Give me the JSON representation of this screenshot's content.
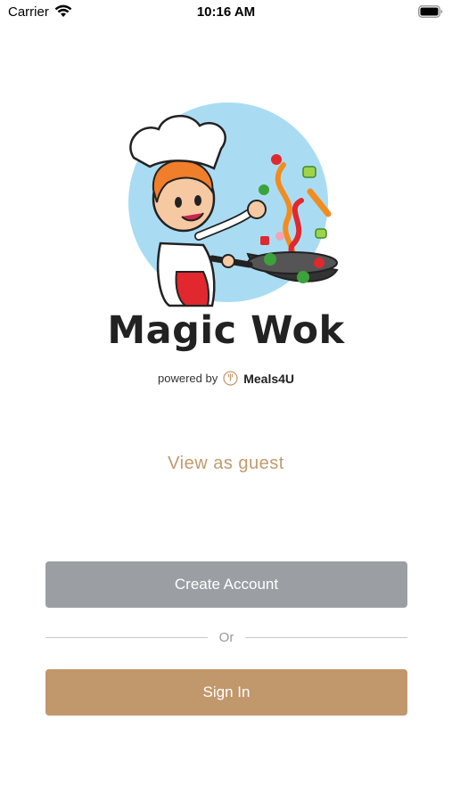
{
  "status_bar": {
    "carrier": "Carrier",
    "time": "10:16 AM"
  },
  "branding": {
    "app_name": "Magic Wok",
    "powered_by_label": "powered by",
    "platform_name": "Meals4U"
  },
  "actions": {
    "guest_label": "View as guest",
    "create_account_label": "Create Account",
    "divider_label": "Or",
    "sign_in_label": "Sign In"
  },
  "colors": {
    "accent_brown": "#c1986c",
    "guest_link": "#c09a6e",
    "create_button": "#9b9fa3",
    "logo_circle": "#a9dcf3"
  },
  "icons": [
    "wifi-icon",
    "battery-icon",
    "chef-wok-logo",
    "meals4u-icon"
  ]
}
